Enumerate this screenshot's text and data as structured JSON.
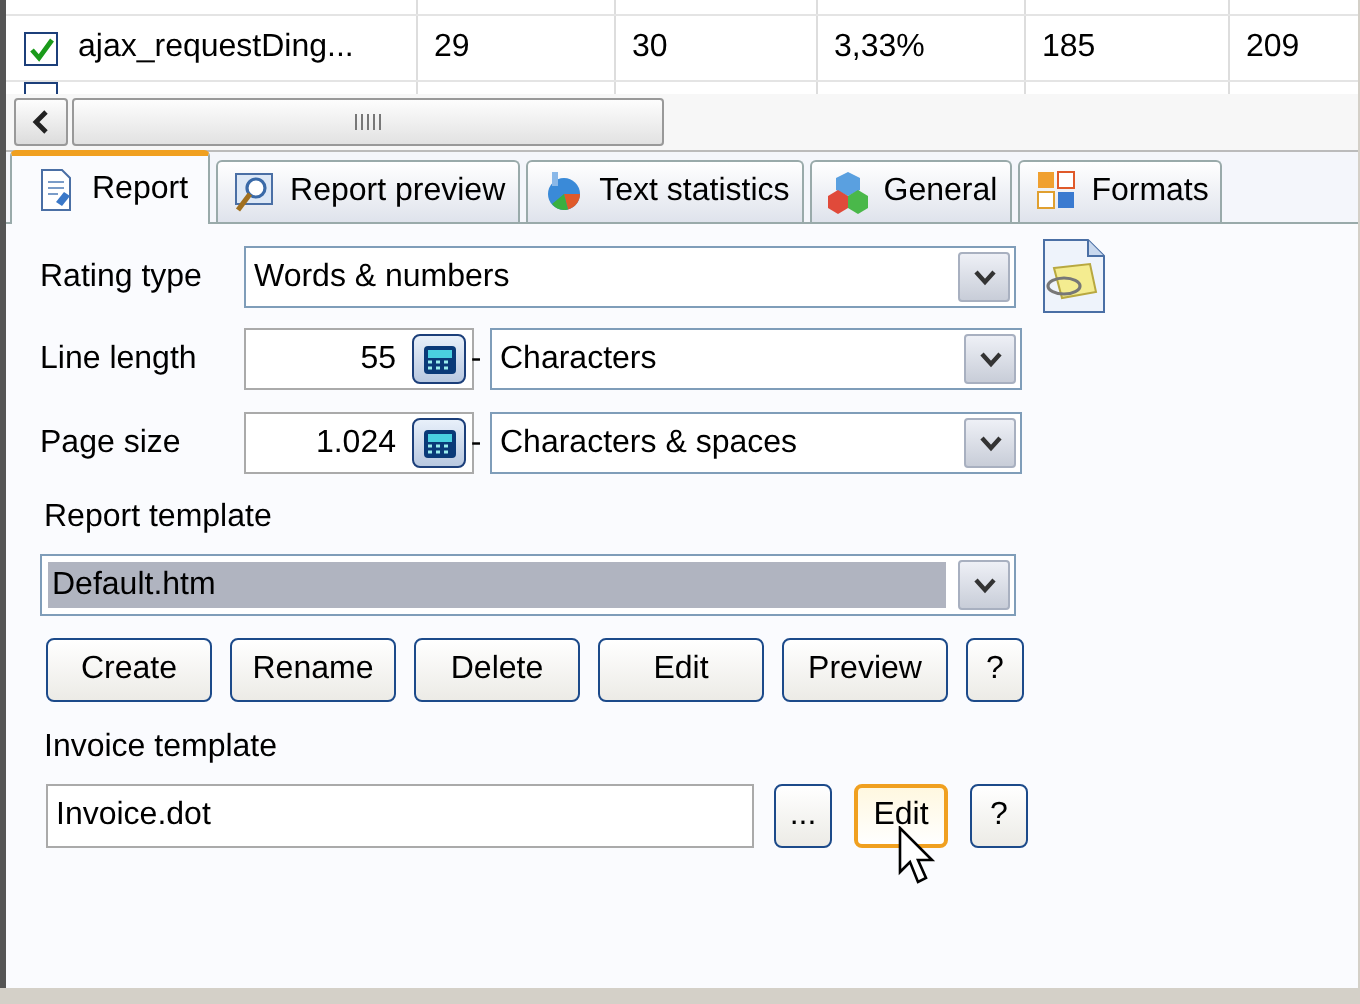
{
  "table": {
    "rows": [
      {
        "checked": true,
        "cells": [
          "ajax_requestDing...",
          "29",
          "30",
          "3,33%",
          "185",
          "209"
        ]
      }
    ]
  },
  "tabs": [
    {
      "label": "Report",
      "selected": true,
      "kind": "report"
    },
    {
      "label": "Report preview",
      "selected": false,
      "kind": "preview"
    },
    {
      "label": "Text statistics",
      "selected": false,
      "kind": "stats"
    },
    {
      "label": "General",
      "selected": false,
      "kind": "general"
    },
    {
      "label": "Formats",
      "selected": false,
      "kind": "formats"
    }
  ],
  "form": {
    "rating_type": {
      "label": "Rating type",
      "value": "Words & numbers"
    },
    "line_length": {
      "label": "Line length",
      "number": "55",
      "separator": "-",
      "unit": "Characters"
    },
    "page_size": {
      "label": "Page size",
      "number": "1.024",
      "separator": "-",
      "unit": "Characters & spaces"
    },
    "report_template": {
      "label": "Report template",
      "value": "Default.htm",
      "selected": true,
      "buttons": [
        {
          "label": "Create",
          "hovered": false
        },
        {
          "label": "Rename",
          "hovered": false
        },
        {
          "label": "Delete",
          "hovered": false
        },
        {
          "label": "Edit",
          "hovered": false
        },
        {
          "label": "Preview",
          "hovered": false
        },
        {
          "label": "?",
          "hovered": false
        }
      ]
    },
    "invoice_template": {
      "label": "Invoice template",
      "value": "Invoice.dot",
      "buttons": [
        {
          "label": "...",
          "hovered": false
        },
        {
          "label": "Edit",
          "hovered": true
        },
        {
          "label": "?",
          "hovered": false
        }
      ]
    }
  }
}
